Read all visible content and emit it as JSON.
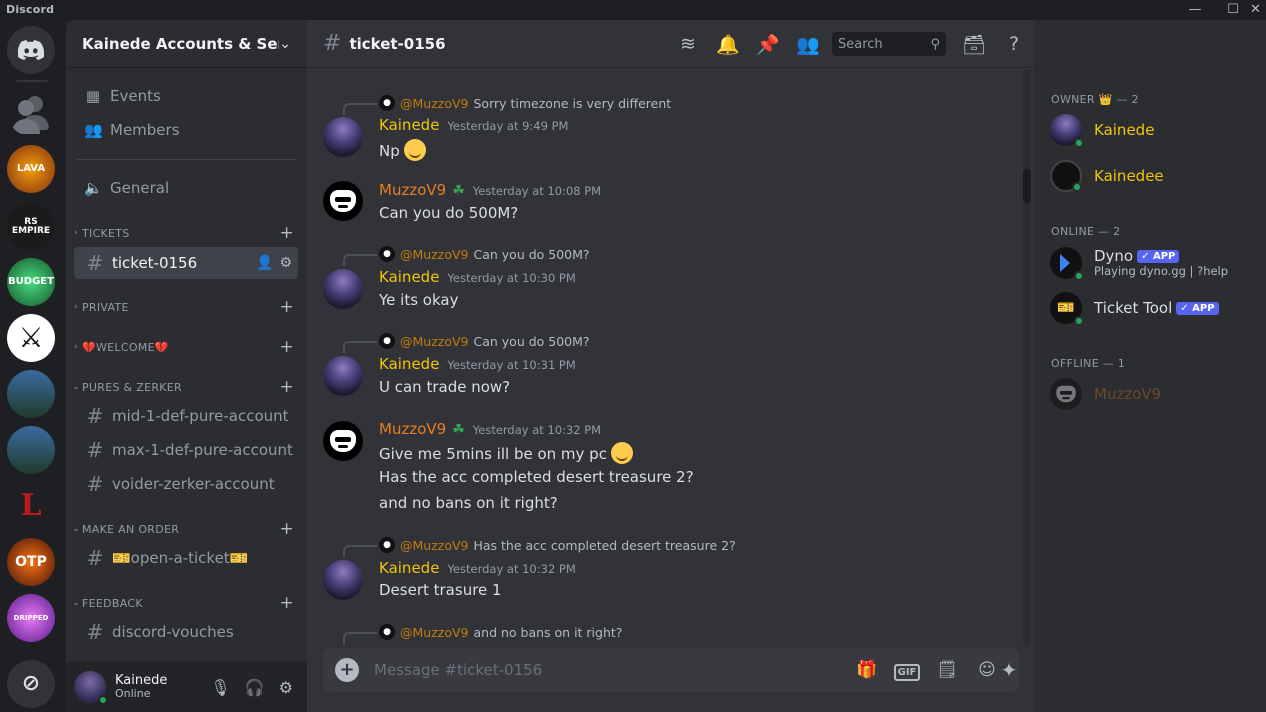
{
  "window": {
    "title": "Discord",
    "minimize": "—",
    "maximize": "☐",
    "close": "✕"
  },
  "rail": {
    "servers": [
      {
        "name": "LAVA SERVICES",
        "label": "LAVA",
        "color": "#c2410c"
      },
      {
        "name": "RS EMPIRE",
        "label": "RS EMPIRE",
        "color": "#7f1d1d"
      },
      {
        "name": "BUDGET SERVICES",
        "label": "BUDGET",
        "color": "#166534"
      },
      {
        "name": "Crossed swords",
        "label": "⚔",
        "color": "#ffffff"
      },
      {
        "name": "Server landscape 1",
        "label": "",
        "color": "#1e3a5f"
      },
      {
        "name": "Server landscape 2",
        "label": "",
        "color": "#1e3a5f"
      },
      {
        "name": "Red L",
        "label": "L",
        "color": "#111111"
      },
      {
        "name": "OTP",
        "label": "OTP",
        "color": "#9a3412"
      },
      {
        "name": "DRIPPED",
        "label": "DRIPPED",
        "color": "#a21caf"
      }
    ]
  },
  "guild": {
    "name": "Kainede Accounts & Ser...",
    "chevron": "⌄"
  },
  "sidebar": {
    "events_label": "Events",
    "members_label": "Members",
    "general_label": "General",
    "categories": {
      "tickets": "TICKETS",
      "private": "PRIVATE",
      "welcome": "💔WELCOME💔",
      "pures": "PURES & ZERKER",
      "order": "MAKE AN ORDER",
      "feedback": "FEEDBACK"
    },
    "channels": {
      "ticket": "ticket-0156",
      "mid": "mid-1-def-pure-account",
      "max": "max-1-def-pure-account",
      "voider": "voider-zerker-account",
      "open": "🎫open-a-ticket🎫",
      "vouches": "discord-vouches"
    }
  },
  "user_panel": {
    "name": "Kainede",
    "status": "Online"
  },
  "chat": {
    "channel": "ticket-0156",
    "search_placeholder": "Search",
    "composer_placeholder": "Message #ticket-0156",
    "gif_label": "GIF",
    "messages": [
      {
        "reply_to": "@MuzzoV9",
        "reply_text": "Sorry timezone is very different",
        "author": "Kainede",
        "time": "Yesterday at 9:49 PM",
        "text": "Np"
      },
      {
        "author": "MuzzoV9",
        "time": "Yesterday at 10:08 PM",
        "text": "Can you do 500M?"
      },
      {
        "reply_to": "@MuzzoV9",
        "reply_text": "Can you do 500M?",
        "author": "Kainede",
        "time": "Yesterday at 10:30 PM",
        "text": "Ye its okay"
      },
      {
        "reply_to": "@MuzzoV9",
        "reply_text": "Can you do 500M?",
        "author": "Kainede",
        "time": "Yesterday at 10:31 PM",
        "text": "U can trade now?"
      },
      {
        "author": "MuzzoV9",
        "time": "Yesterday at 10:32 PM",
        "lines": [
          "Give me 5mins ill be on my pc",
          "Has the acc completed desert treasure 2?",
          "and no bans on it right?"
        ]
      },
      {
        "reply_to": "@MuzzoV9",
        "reply_text": "Has the acc completed desert treasure 2?",
        "author": "Kainede",
        "time": "Yesterday at 10:32 PM",
        "text": "Desert trasure 1"
      },
      {
        "reply_to": "@MuzzoV9",
        "reply_text": "and no bans on it right?"
      }
    ]
  },
  "members_list": {
    "owner_header": "OWNER 👑 — 2",
    "online_header": "ONLINE — 2",
    "offline_header": "OFFLINE — 1",
    "owners": [
      "Kainede",
      "Kainedee"
    ],
    "online": [
      {
        "name": "Dyno",
        "badge": "✓ APP",
        "activity": "Playing dyno.gg | ?help"
      },
      {
        "name": "Ticket Tool",
        "badge": "✓ APP"
      }
    ],
    "offline": [
      "MuzzoV9"
    ]
  }
}
